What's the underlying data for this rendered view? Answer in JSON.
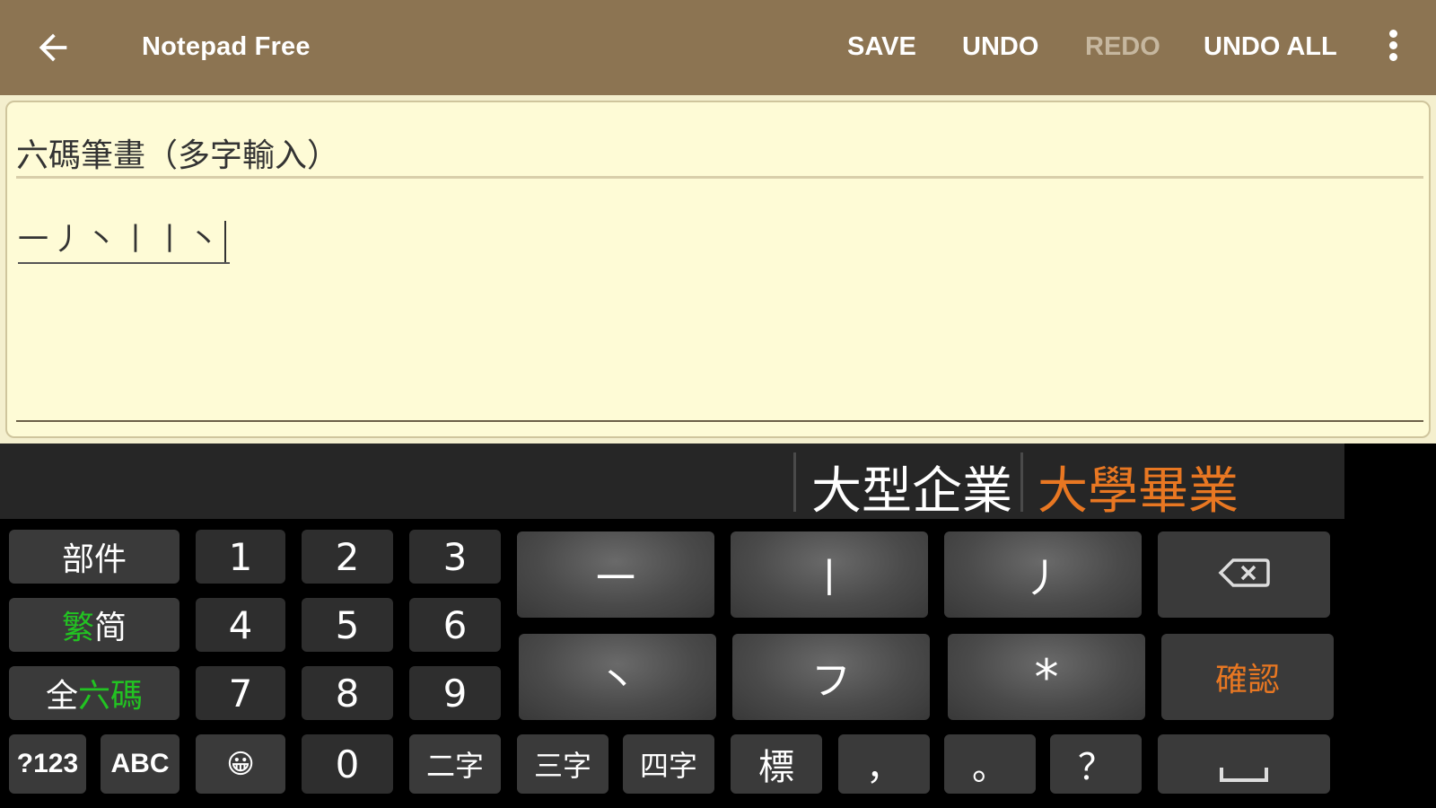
{
  "appbar": {
    "title": "Notepad Free",
    "actions": {
      "save": "SAVE",
      "undo": "UNDO",
      "redo": "REDO",
      "undo_all": "UNDO ALL"
    },
    "redo_enabled": false
  },
  "note": {
    "title": "六碼筆畫（多字輸入）",
    "body": "一丿丶丨丨丶"
  },
  "keyboard": {
    "candidates": [
      {
        "text": "大型企業",
        "highlighted": false
      },
      {
        "text": "大學畢業",
        "highlighted": true
      }
    ],
    "keys": {
      "components": "部件",
      "trad_simp_green": "繁",
      "trad_simp_rest": "简",
      "full_prefix": "全",
      "full_green": "六碼",
      "digits": [
        "1",
        "2",
        "3",
        "4",
        "5",
        "6",
        "7",
        "8",
        "9",
        "0"
      ],
      "symbols_mode": "?123",
      "abc_mode": "ABC",
      "emoji": "😀",
      "two_char": "二字",
      "three_char": "三字",
      "four_char": "四字",
      "punct_mark": "標",
      "comma": "，",
      "period": "。",
      "question": "？",
      "stroke_horizontal": "一",
      "stroke_vertical": "丨",
      "stroke_left_falling": "丿",
      "stroke_dot": "丶",
      "stroke_turning": "フ",
      "wildcard": "*",
      "confirm": "確認"
    },
    "colors": {
      "highlight": "#e87722",
      "green": "#22c322",
      "appbar": "#8c7452",
      "paper": "#fefbd6"
    }
  }
}
